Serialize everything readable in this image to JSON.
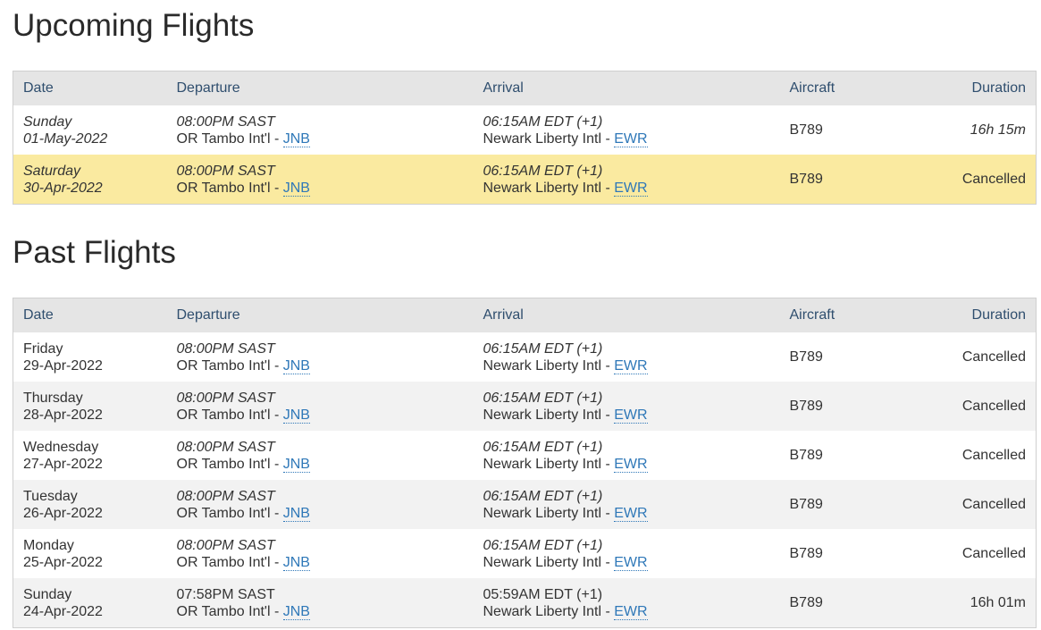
{
  "upcoming": {
    "title": "Upcoming Flights",
    "headers": {
      "date": "Date",
      "departure": "Departure",
      "arrival": "Arrival",
      "aircraft": "Aircraft",
      "duration": "Duration"
    },
    "rows": [
      {
        "day": "Sunday",
        "date": "01-May-2022",
        "dep_time": "08:00PM SAST",
        "dep_airport": "OR Tambo Int'l - ",
        "dep_code": "JNB",
        "arr_time": "06:15AM EDT (+1)",
        "arr_airport": "Newark Liberty Intl - ",
        "arr_code": "EWR",
        "aircraft": "B789",
        "duration": "16h 15m"
      },
      {
        "day": "Saturday",
        "date": "30-Apr-2022",
        "dep_time": "08:00PM SAST",
        "dep_airport": "OR Tambo Int'l - ",
        "dep_code": "JNB",
        "arr_time": "06:15AM EDT (+1)",
        "arr_airport": "Newark Liberty Intl - ",
        "arr_code": "EWR",
        "aircraft": "B789",
        "duration": "Cancelled"
      }
    ]
  },
  "past": {
    "title": "Past Flights",
    "headers": {
      "date": "Date",
      "departure": "Departure",
      "arrival": "Arrival",
      "aircraft": "Aircraft",
      "duration": "Duration"
    },
    "rows": [
      {
        "day": "Friday",
        "date": "29-Apr-2022",
        "dep_time": "08:00PM SAST",
        "dep_airport": "OR Tambo Int'l - ",
        "dep_code": "JNB",
        "arr_time": "06:15AM EDT (+1)",
        "arr_airport": "Newark Liberty Intl - ",
        "arr_code": "EWR",
        "aircraft": "B789",
        "duration": "Cancelled"
      },
      {
        "day": "Thursday",
        "date": "28-Apr-2022",
        "dep_time": "08:00PM SAST",
        "dep_airport": "OR Tambo Int'l - ",
        "dep_code": "JNB",
        "arr_time": "06:15AM EDT (+1)",
        "arr_airport": "Newark Liberty Intl - ",
        "arr_code": "EWR",
        "aircraft": "B789",
        "duration": "Cancelled"
      },
      {
        "day": "Wednesday",
        "date": "27-Apr-2022",
        "dep_time": "08:00PM SAST",
        "dep_airport": "OR Tambo Int'l - ",
        "dep_code": "JNB",
        "arr_time": "06:15AM EDT (+1)",
        "arr_airport": "Newark Liberty Intl - ",
        "arr_code": "EWR",
        "aircraft": "B789",
        "duration": "Cancelled"
      },
      {
        "day": "Tuesday",
        "date": "26-Apr-2022",
        "dep_time": "08:00PM SAST",
        "dep_airport": "OR Tambo Int'l - ",
        "dep_code": "JNB",
        "arr_time": "06:15AM EDT (+1)",
        "arr_airport": "Newark Liberty Intl - ",
        "arr_code": "EWR",
        "aircraft": "B789",
        "duration": "Cancelled"
      },
      {
        "day": "Monday",
        "date": "25-Apr-2022",
        "dep_time": "08:00PM SAST",
        "dep_airport": "OR Tambo Int'l - ",
        "dep_code": "JNB",
        "arr_time": "06:15AM EDT (+1)",
        "arr_airport": "Newark Liberty Intl - ",
        "arr_code": "EWR",
        "aircraft": "B789",
        "duration": "Cancelled"
      },
      {
        "day": "Sunday",
        "date": "24-Apr-2022",
        "dep_time": "07:58PM SAST",
        "dep_airport": "OR Tambo Int'l - ",
        "dep_code": "JNB",
        "arr_time": "05:59AM EDT (+1)",
        "arr_airport": "Newark Liberty Intl - ",
        "arr_code": "EWR",
        "aircraft": "B789",
        "duration": "16h 01m"
      }
    ]
  }
}
